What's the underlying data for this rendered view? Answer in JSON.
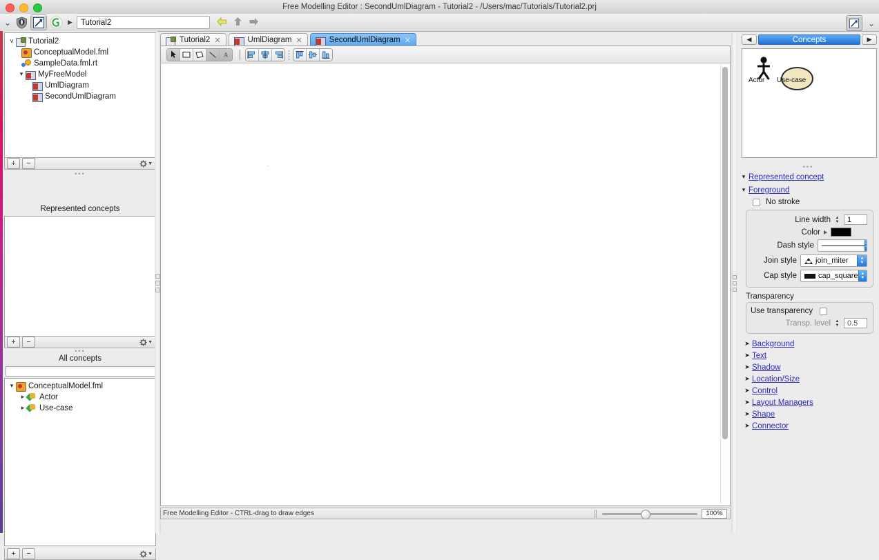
{
  "window": {
    "title": "Free Modelling Editor : SecondUmlDiagram - Tutorial2 - /Users/mac/Tutorials/Tutorial2.prj"
  },
  "toolbar": {
    "chevron_icon": "double-chevron-down-icon",
    "shield_icon": "shield-app-icon",
    "editor_icon": "diagram-editor-icon",
    "openflexo_icon": "openflexo-logo-icon",
    "path_arrow_icon": "chevron-right-icon",
    "address_value": "Tutorial2",
    "back_icon": "back-arrow-icon",
    "up_icon": "up-arrow-icon",
    "forward_icon": "forward-arrow-icon",
    "right_editor_icon": "diagram-editor-icon",
    "right_chevron_icon": "double-chevron-down-icon"
  },
  "project_tree": {
    "items": [
      {
        "label": "Tutorial2",
        "indent": 0,
        "twisty": "v",
        "icon": "project-icon"
      },
      {
        "label": "ConceptualModel.fml",
        "indent": 1,
        "twisty": "",
        "icon": "fml-model-icon"
      },
      {
        "label": "SampleData.fml.rt",
        "indent": 1,
        "twisty": "",
        "icon": "fml-runtime-icon"
      },
      {
        "label": "MyFreeModel",
        "indent": 1,
        "twisty": "v",
        "icon": "free-model-icon"
      },
      {
        "label": "UmlDiagram",
        "indent": 2,
        "twisty": "",
        "icon": "diagram-icon"
      },
      {
        "label": "SecondUmlDiagram",
        "indent": 2,
        "twisty": "",
        "icon": "diagram-icon"
      }
    ],
    "add_label": "+",
    "remove_label": "−",
    "gear_icon": "gear-icon"
  },
  "represented_concepts": {
    "caption": "Represented concepts",
    "grip": "•••",
    "items": [],
    "add_label": "+",
    "remove_label": "−",
    "gear_icon": "gear-icon"
  },
  "all_concepts": {
    "caption": "All concepts",
    "grip": "•••",
    "search_value": "",
    "search_placeholder": "",
    "items": [
      {
        "label": "ConceptualModel.fml",
        "indent": 0,
        "twisty": "v",
        "icon": "fml-model-icon"
      },
      {
        "label": "Actor",
        "indent": 1,
        "twisty": ">",
        "icon": "concept-icon"
      },
      {
        "label": "Use-case",
        "indent": 1,
        "twisty": ">",
        "icon": "concept-icon"
      }
    ],
    "add_label": "+",
    "remove_label": "−",
    "gear_icon": "gear-icon"
  },
  "editor": {
    "tabs": [
      {
        "label": "Tutorial2",
        "icon": "project-icon",
        "close": "✕",
        "active": false
      },
      {
        "label": "UmlDiagram",
        "icon": "diagram-icon",
        "close": "✕",
        "active": false
      },
      {
        "label": "SecondUmlDiagram",
        "icon": "diagram-icon",
        "close": "✕",
        "active": true
      }
    ],
    "tools": [
      {
        "name": "select-tool",
        "state": "on"
      },
      {
        "name": "rectangle-tool",
        "state": "off"
      },
      {
        "name": "polygon-tool",
        "state": "off"
      },
      {
        "name": "line-tool",
        "state": "dim"
      },
      {
        "name": "text-tool",
        "state": "dim"
      }
    ],
    "align_tools": [
      {
        "name": "align-left-icon"
      },
      {
        "name": "align-center-icon"
      },
      {
        "name": "align-right-icon"
      }
    ],
    "distribute_tools": [
      {
        "name": "align-top-icon"
      },
      {
        "name": "align-middle-icon"
      },
      {
        "name": "align-bottom-icon"
      }
    ]
  },
  "status": {
    "message": "Free Modelling Editor - CTRL-drag to draw edges",
    "zoom_value": "100%",
    "zoom_percent": 100
  },
  "palette": {
    "prev_icon": "◀",
    "next_icon": "▶",
    "title": "Concepts",
    "items": [
      {
        "label": "Actor",
        "shape": "actor-stick-figure"
      },
      {
        "label": "Use-case",
        "shape": "usecase-ellipse"
      }
    ]
  },
  "inspector": {
    "grip": "•••",
    "represented_concept": {
      "label": "Represented concept",
      "twisty": "v"
    },
    "foreground": {
      "label": "Foreground",
      "twisty": "v",
      "no_stroke_label": "No stroke",
      "no_stroke_checked": false,
      "line_width_label": "Line width",
      "line_width_value": "1",
      "color_label": "Color",
      "color_value": "#000000",
      "dash_style_label": "Dash style",
      "dash_style_value": "",
      "join_style_label": "Join style",
      "join_style_value": "join_miter",
      "cap_style_label": "Cap style",
      "cap_style_value": "cap_square"
    },
    "transparency": {
      "group_label": "Transparency",
      "use_transparency_label": "Use transparency",
      "use_transparency_checked": false,
      "level_label": "Transp. level",
      "level_value": "0.5"
    },
    "sections": [
      {
        "label": "Background",
        "twisty": ">"
      },
      {
        "label": "Text",
        "twisty": ">"
      },
      {
        "label": "Shadow",
        "twisty": ">"
      },
      {
        "label": "Location/Size",
        "twisty": ">"
      },
      {
        "label": "Control",
        "twisty": ">"
      },
      {
        "label": "Layout Managers",
        "twisty": ">"
      },
      {
        "label": "Shape",
        "twisty": ">"
      },
      {
        "label": "Connector",
        "twisty": ">"
      }
    ]
  },
  "colors": {
    "accent": "#1d73db",
    "tab_active": "#5aa7ef",
    "link": "#2b2bbf",
    "usecase_fill": "#f0e6c0"
  }
}
